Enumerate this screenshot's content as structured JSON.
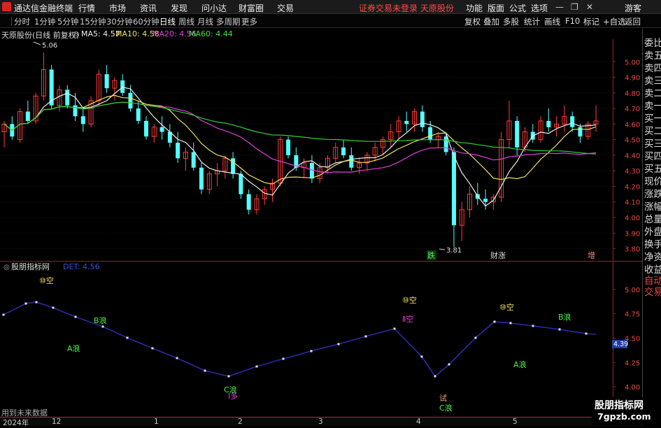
{
  "app": {
    "name": "通达信金融终端",
    "menus": [
      "行情",
      "市场",
      "资讯",
      "发现",
      "问小达",
      "财富圈",
      "交易"
    ],
    "warning": "证券交易未登录  天原股份",
    "right_menus": [
      "功能",
      "版面",
      "公式",
      "选项"
    ],
    "window_controls": [
      "—",
      "❐",
      "✕"
    ],
    "guest": "游客"
  },
  "periods": [
    "分时",
    "1分钟",
    "5分钟",
    "15分钟",
    "30分钟",
    "60分钟",
    "日线",
    "周线",
    "月线",
    "多周期",
    "更多"
  ],
  "active_period": "日线",
  "tools": [
    "复权",
    "叠加",
    "多股",
    "统计",
    "画线",
    "F10",
    "标记",
    "+自选",
    "返回"
  ],
  "info": {
    "stock": "天原股份(日线 前复权)",
    "ma5": "MA5: 4.57",
    "ma10": "MA10: 4.58",
    "ma20": "MA20: 4.56",
    "ma60": "MA60: 4.44"
  },
  "indicator": {
    "name": "股朋指标网",
    "value": "DET: 4.56",
    "current": "4.39",
    "future_label": "用到未来数据"
  },
  "annotations": {
    "high": "5.06",
    "low": "3.81",
    "die": "跌",
    "caizhang": "财涨",
    "zeng": "增"
  },
  "wave_labels": [
    "⑩空",
    "B浪",
    "A浪",
    "C浪",
    "Ⅰ多",
    "⑩空",
    "Ⅱ空",
    "试",
    "C浪",
    "⑩空",
    "B浪",
    "A浪"
  ],
  "right_panel": [
    "委比",
    "卖五",
    "卖四",
    "卖三",
    "卖二",
    "卖一",
    "买一",
    "买二",
    "买三",
    "买四",
    "买五",
    "现价",
    "涨跌",
    "涨幅",
    "总量",
    "外盘",
    "换手",
    "净资",
    "收益",
    "自动",
    "交易"
  ],
  "price_axis": [
    "5.00",
    "4.90",
    "4.80",
    "4.70",
    "4.60",
    "4.50",
    "4.40",
    "4.30",
    "4.20",
    "4.10",
    "4.00",
    "3.90",
    "3.80"
  ],
  "ind_axis": [
    "5.00",
    "4.75",
    "4.50",
    "4.25",
    "4.00"
  ],
  "time_axis": [
    "2024年",
    "12",
    "1",
    "2",
    "3",
    "4",
    "5"
  ],
  "watermark": {
    "line1": "股朋指标网",
    "line2": "7gpzb.com"
  },
  "chart_data": {
    "type": "candlestick",
    "ylim": [
      3.78,
      5.1
    ],
    "ma_periods": [
      5,
      10,
      20,
      60
    ],
    "ind_ylim": [
      3.95,
      5.1
    ],
    "candles": [
      [
        4.55,
        4.62,
        4.45,
        4.6
      ],
      [
        4.6,
        4.65,
        4.5,
        4.52
      ],
      [
        4.5,
        4.7,
        4.48,
        4.68
      ],
      [
        4.68,
        4.75,
        4.6,
        4.62
      ],
      [
        4.62,
        4.8,
        4.6,
        4.78
      ],
      [
        4.78,
        5.06,
        4.75,
        4.95
      ],
      [
        4.95,
        4.98,
        4.7,
        4.72
      ],
      [
        4.72,
        4.85,
        4.68,
        4.82
      ],
      [
        4.82,
        4.85,
        4.7,
        4.72
      ],
      [
        4.72,
        4.8,
        4.62,
        4.65
      ],
      [
        4.65,
        4.7,
        4.55,
        4.6
      ],
      [
        4.6,
        4.78,
        4.58,
        4.75
      ],
      [
        4.75,
        4.95,
        4.72,
        4.92
      ],
      [
        4.92,
        4.98,
        4.8,
        4.83
      ],
      [
        4.83,
        4.9,
        4.75,
        4.88
      ],
      [
        4.88,
        4.92,
        4.78,
        4.8
      ],
      [
        4.8,
        4.85,
        4.68,
        4.7
      ],
      [
        4.7,
        4.75,
        4.6,
        4.62
      ],
      [
        4.62,
        4.65,
        4.5,
        4.52
      ],
      [
        4.52,
        4.6,
        4.48,
        4.58
      ],
      [
        4.58,
        4.65,
        4.5,
        4.55
      ],
      [
        4.55,
        4.6,
        4.45,
        4.48
      ],
      [
        4.48,
        4.55,
        4.35,
        4.38
      ],
      [
        4.38,
        4.45,
        4.3,
        4.42
      ],
      [
        4.42,
        4.48,
        4.3,
        4.32
      ],
      [
        4.32,
        4.35,
        4.15,
        4.18
      ],
      [
        4.18,
        4.3,
        4.15,
        4.28
      ],
      [
        4.28,
        4.35,
        4.2,
        4.3
      ],
      [
        4.3,
        4.4,
        4.25,
        4.38
      ],
      [
        4.38,
        4.42,
        4.25,
        4.28
      ],
      [
        4.28,
        4.3,
        4.12,
        4.15
      ],
      [
        4.15,
        4.18,
        4.02,
        4.05
      ],
      [
        4.05,
        4.15,
        4.02,
        4.12
      ],
      [
        4.12,
        4.2,
        4.08,
        4.18
      ],
      [
        4.18,
        4.25,
        4.1,
        4.22
      ],
      [
        4.22,
        4.52,
        4.2,
        4.5
      ],
      [
        4.5,
        4.52,
        4.38,
        4.4
      ],
      [
        4.4,
        4.45,
        4.3,
        4.32
      ],
      [
        4.32,
        4.38,
        4.25,
        4.35
      ],
      [
        4.35,
        4.4,
        4.22,
        4.25
      ],
      [
        4.25,
        4.35,
        4.22,
        4.32
      ],
      [
        4.32,
        4.4,
        4.28,
        4.38
      ],
      [
        4.38,
        4.48,
        4.35,
        4.45
      ],
      [
        4.45,
        4.5,
        4.38,
        4.4
      ],
      [
        4.4,
        4.45,
        4.3,
        4.32
      ],
      [
        4.32,
        4.38,
        4.28,
        4.35
      ],
      [
        4.35,
        4.42,
        4.3,
        4.4
      ],
      [
        4.4,
        4.48,
        4.36,
        4.45
      ],
      [
        4.45,
        4.52,
        4.4,
        4.5
      ],
      [
        4.5,
        4.6,
        4.45,
        4.55
      ],
      [
        4.55,
        4.65,
        4.5,
        4.62
      ],
      [
        4.62,
        4.68,
        4.55,
        4.6
      ],
      [
        4.6,
        4.7,
        4.55,
        4.68
      ],
      [
        4.68,
        4.72,
        4.55,
        4.58
      ],
      [
        4.58,
        4.62,
        4.48,
        4.5
      ],
      [
        4.5,
        4.55,
        4.45,
        4.52
      ],
      [
        4.52,
        4.55,
        4.4,
        4.42
      ],
      [
        4.42,
        4.45,
        3.81,
        3.95
      ],
      [
        3.95,
        4.1,
        3.85,
        4.05
      ],
      [
        4.05,
        4.2,
        4.0,
        4.15
      ],
      [
        4.15,
        4.22,
        4.08,
        4.12
      ],
      [
        4.12,
        4.18,
        4.05,
        4.1
      ],
      [
        4.1,
        4.15,
        4.05,
        4.13
      ],
      [
        4.13,
        4.55,
        4.1,
        4.5
      ],
      [
        4.5,
        4.75,
        4.45,
        4.62
      ],
      [
        4.62,
        4.65,
        4.4,
        4.45
      ],
      [
        4.45,
        4.58,
        4.42,
        4.55
      ],
      [
        4.55,
        4.6,
        4.48,
        4.5
      ],
      [
        4.5,
        4.65,
        4.48,
        4.62
      ],
      [
        4.62,
        4.7,
        4.55,
        4.58
      ],
      [
        4.58,
        4.65,
        4.52,
        4.6
      ],
      [
        4.6,
        4.72,
        4.55,
        4.65
      ],
      [
        4.65,
        4.68,
        4.55,
        4.58
      ],
      [
        4.58,
        4.6,
        4.48,
        4.52
      ],
      [
        4.52,
        4.62,
        4.5,
        4.6
      ],
      [
        4.6,
        4.72,
        4.55,
        4.62
      ]
    ],
    "ind_points": [
      4.85,
      4.98,
      5.0,
      4.93,
      4.87,
      4.82,
      4.7,
      4.58,
      4.46,
      4.36,
      4.27,
      4.18,
      4.09,
      4.05,
      4.12,
      4.24,
      4.36,
      4.48,
      4.6,
      4.67,
      4.5,
      4.38,
      4.05,
      4.15,
      4.3,
      4.5,
      4.75,
      4.74,
      4.7,
      4.68,
      4.65,
      4.6
    ]
  }
}
